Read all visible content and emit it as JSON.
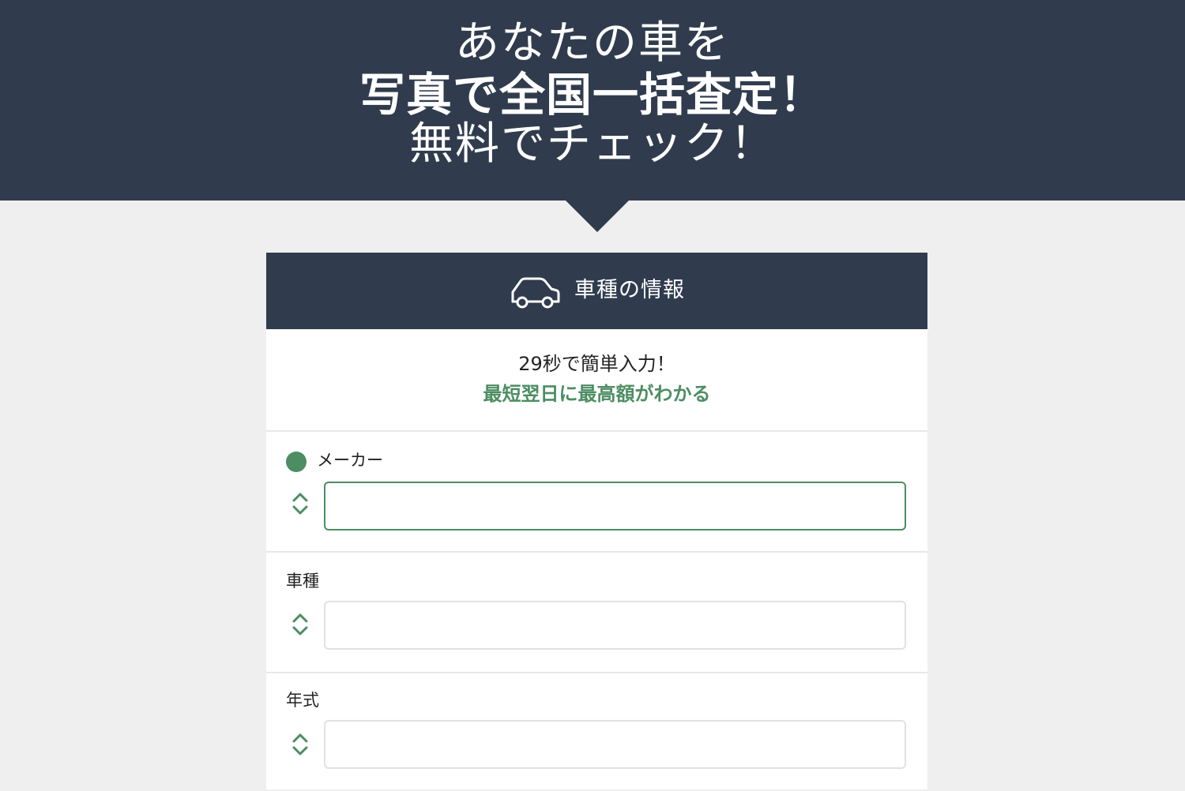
{
  "hero": {
    "line1": "あなたの車を",
    "line2": "写真で全国一括査定！",
    "line3": "無料でチェック！"
  },
  "panel": {
    "title": "車種の情報",
    "car_icon": "car-outline-icon",
    "intro_line1": "29秒で簡単入力！",
    "intro_line2": "最短翌日に最高額がわかる"
  },
  "fields": {
    "maker": {
      "label": "メーカー",
      "value": "",
      "required_icon": "required-dot-icon"
    },
    "model": {
      "label": "車種",
      "value": ""
    },
    "year": {
      "label": "年式",
      "value": ""
    }
  },
  "colors": {
    "navy": "#303c4e",
    "accent_green": "#4c8d62",
    "background": "#efefef"
  }
}
